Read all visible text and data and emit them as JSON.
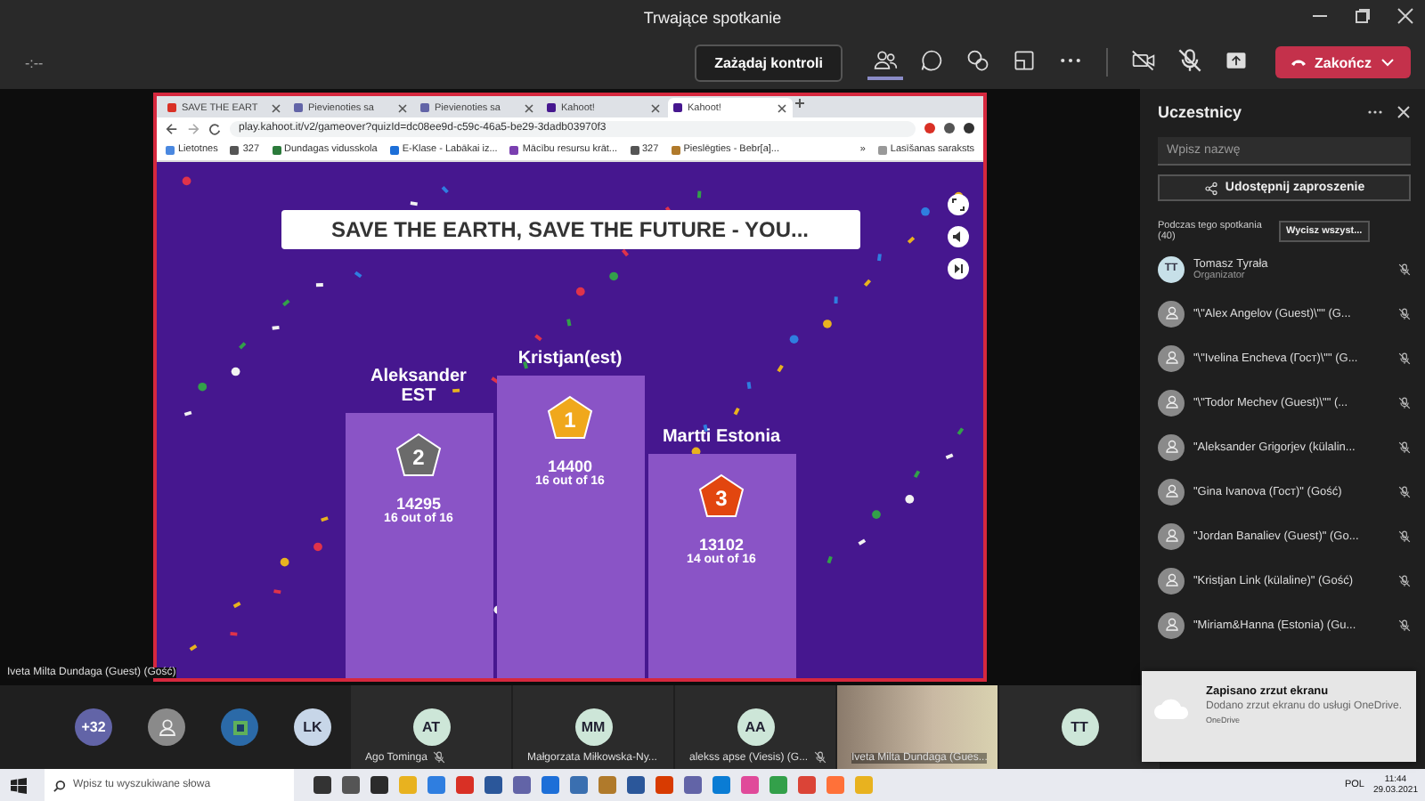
{
  "window": {
    "title": "Trwające spotkanie"
  },
  "toolbar": {
    "timer": "-:--",
    "request_control": "Zażądaj kontroli",
    "participants_selected": true,
    "leave": "Zakończ"
  },
  "shared_screen": {
    "browser": {
      "tabs": [
        {
          "title": "SAVE THE EART",
          "selected": false
        },
        {
          "title": "Pievienoties sa",
          "selected": false
        },
        {
          "title": "Pievienoties sa",
          "selected": false
        },
        {
          "title": "Kahoot!",
          "selected": false
        },
        {
          "title": "Kahoot!",
          "selected": true
        }
      ],
      "url": "play.kahoot.it/v2/gameover?quizId=dc08ee9d-c59c-46a5-be29-3dadb03970f3",
      "bookmarks": [
        "Lietotnes",
        "327",
        "Dundagas vidusskola",
        "E-Klase - Labākai iz...",
        "Mācību resursu krāt...",
        "327",
        "Pieslēgties - Bebr[a]..."
      ],
      "bookmarks_more": "»",
      "reading_list": "Lasīšanas saraksts"
    },
    "kahoot": {
      "title": "SAVE THE EARTH, SAVE THE FUTURE - YOU...",
      "podium": [
        {
          "place": "2",
          "name": "Aleksander EST",
          "score": "14295",
          "result": "16 out of 16"
        },
        {
          "place": "1",
          "name": "Kristjan(est)",
          "score": "14400",
          "result": "16 out of 16"
        },
        {
          "place": "3",
          "name": "Martti Estonia",
          "score": "13102",
          "result": "14 out of 16"
        }
      ]
    },
    "presenter_label": "Iveta Milta Dundaga (Guest) (Gość)"
  },
  "participants_panel": {
    "title": "Uczestnicy",
    "search_placeholder": "Wpisz nazwę",
    "invite": "Udostępnij zaproszenie",
    "section": "Podczas tego spotkania (40)",
    "mute_all": "Wycisz wszyst...",
    "participants": [
      {
        "name": "Tomasz Tyrała",
        "role": "Organizator",
        "initials": "TT",
        "muted": true
      },
      {
        "name": "\"\\\"Alex Angelov (Guest)\\\"\" (G...",
        "muted": true
      },
      {
        "name": "\"\\\"Ivelina Encheva (Гост)\\\"\" (G...",
        "muted": true
      },
      {
        "name": "\"\\\"Todor Mechev (Guest)\\\"\" (...",
        "muted": true
      },
      {
        "name": "\"Aleksander Grigorjev (külalin...",
        "muted": true
      },
      {
        "name": "\"Gina Ivanova (Гост)\" (Gość)",
        "muted": true
      },
      {
        "name": "\"Jordan Banaliev (Guest)\" (Go...",
        "muted": true
      },
      {
        "name": "\"Kristjan Link (külaline)\" (Gość)",
        "muted": true
      },
      {
        "name": "\"Miriam&Hanna (Estonia) (Gu...",
        "muted": true
      }
    ]
  },
  "video_strip": [
    {
      "kind": "count",
      "text": "+32"
    },
    {
      "kind": "generic"
    },
    {
      "kind": "picture"
    },
    {
      "kind": "initials",
      "initials": "LK"
    },
    {
      "kind": "tile",
      "initials": "AT",
      "name": "Ago Tominga",
      "muted": true
    },
    {
      "kind": "tile",
      "initials": "MM",
      "name": "Małgorzata Miłkowska-Ny...",
      "muted": false
    },
    {
      "kind": "tile",
      "initials": "AA",
      "name": "alekss apse (Viesis) (G...",
      "muted": true
    },
    {
      "kind": "video",
      "name": "Iveta Milta Dundaga (Gues...",
      "muted": false
    },
    {
      "kind": "tile",
      "initials": "TT",
      "muted": false
    }
  ],
  "toast": {
    "title": "Zapisano zrzut ekranu",
    "body": "Dodano zrzut ekranu do usługi OneDrive.",
    "source": "OneDrive"
  },
  "taskbar": {
    "search_placeholder": "Wpisz tu wyszukiwane słowa",
    "language": "POL",
    "time": "11:44",
    "date": "29.03.2021"
  }
}
